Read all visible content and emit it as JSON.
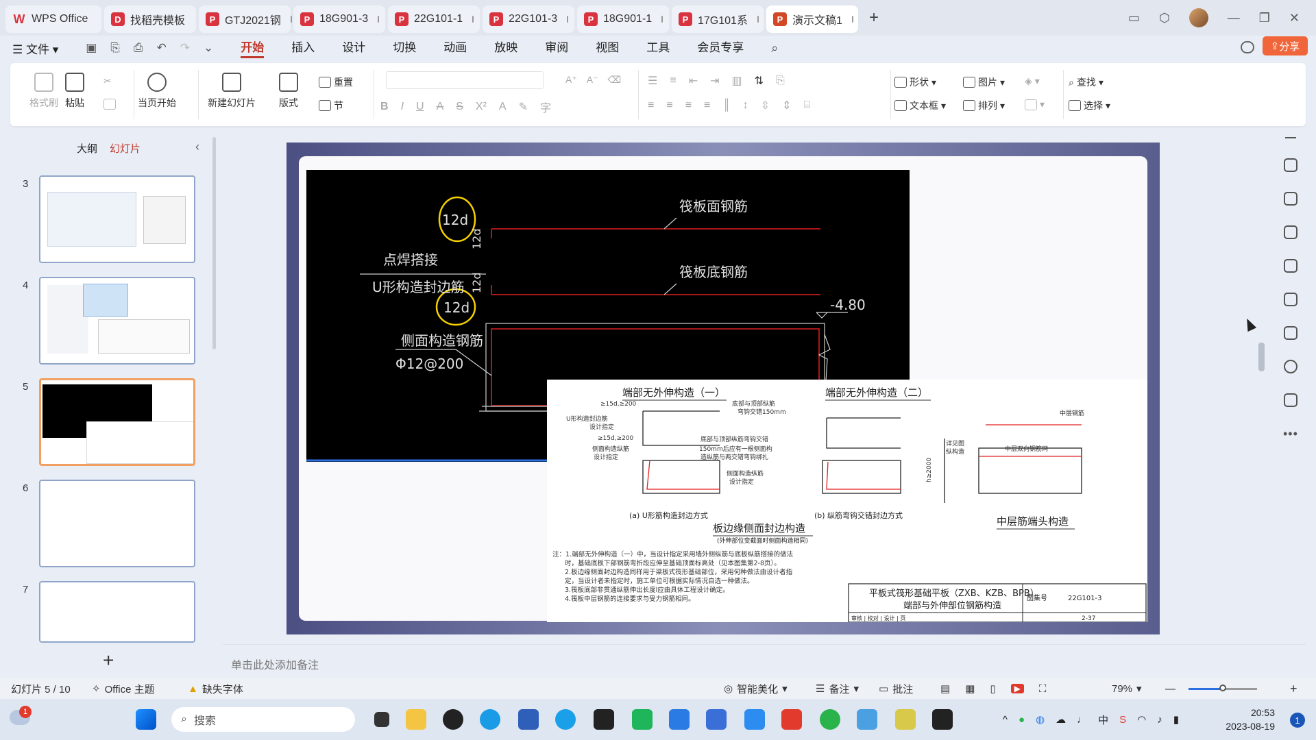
{
  "tabs": [
    {
      "label": "WPS Office",
      "icon": "W",
      "kind": "home"
    },
    {
      "label": "找稻壳模板",
      "icon": "D",
      "kind": "template"
    },
    {
      "label": "GTJ2021钢",
      "icon": "P",
      "kind": "pdf"
    },
    {
      "label": "18G901-3",
      "icon": "P",
      "kind": "pdf"
    },
    {
      "label": "22G101-1",
      "icon": "P",
      "kind": "pdf"
    },
    {
      "label": "22G101-3",
      "icon": "P",
      "kind": "pdf"
    },
    {
      "label": "18G901-1",
      "icon": "P",
      "kind": "pdf"
    },
    {
      "label": "17G101系",
      "icon": "P",
      "kind": "pdf"
    },
    {
      "label": "演示文稿1",
      "icon": "P",
      "kind": "ppt",
      "active": true
    }
  ],
  "menu": {
    "file": "文件",
    "items": [
      "开始",
      "插入",
      "设计",
      "切换",
      "动画",
      "放映",
      "审阅",
      "视图",
      "工具",
      "会员专享"
    ],
    "active": "开始",
    "share": "分享"
  },
  "ribbon": {
    "format_painter": "格式刷",
    "paste": "粘贴",
    "from_current": "当页开始",
    "new_slide": "新建幻灯片",
    "layout": "版式",
    "reset": "重置",
    "section": "节",
    "shape": "形状",
    "picture": "图片",
    "find": "查找",
    "textbox": "文本框",
    "arrange": "排列",
    "select": "选择"
  },
  "left_panel": {
    "tab_outline": "大纲",
    "tab_slides": "幻灯片",
    "slides": [
      {
        "number": "3"
      },
      {
        "number": "4"
      },
      {
        "number": "5",
        "selected": true
      },
      {
        "number": "6"
      },
      {
        "number": "7"
      }
    ]
  },
  "cad": {
    "labels": [
      "12d",
      "12d",
      "12d",
      "12d",
      "点焊搭接",
      "U形构造封边筋",
      "侧面构造钢筋",
      "Φ12@200",
      "筏板面钢筋",
      "筏板底钢筋",
      "-4.80"
    ]
  },
  "paper": {
    "title1": "端部无外伸构造（一）",
    "title2": "端部无外伸构造（二）",
    "sub_a": "(a) U形筋构造封边方式",
    "sub_b": "(b) 纵筋弯钩交错封边方式",
    "caption_main": "板边缘侧面封边构造",
    "caption_note": "(外伸部位变截面时侧面构造相同)",
    "caption_mid": "中层筋端头构造",
    "small_labels": [
      "≥15d,≥200",
      "U形构造封边筋",
      "设计指定",
      "≥15d,≥200",
      "侧面构造纵筋",
      "设计指定",
      "底部与顶部纵筋",
      "弯钩交错150mm",
      "底部与顶部纵筋弯钩交错",
      "150mm后应有一根侧面构",
      "造纵筋与两交错弯钩绑扎",
      "侧面构造纵筋",
      "设计指定",
      "中层钢筋",
      "详见图",
      "纵构造",
      "中层双向钢筋网",
      "h≥2000"
    ],
    "notes": [
      "注：1.端部无外伸构造（一）中，当设计指定采用墙外侧纵筋与底板纵筋搭接的做法",
      "时，基础底板下部钢筋弯折段应伸至基础顶面标高处（见本图集第2-8页）。",
      "2.板边缘侧面封边构造同样用于梁板式筏形基础部位，采用何种做法由设计者指",
      "定，当设计者未指定时，施工单位可根据实际情况自选一种做法。",
      "3.筏板底部非贯通纵筋伸出长度l应由具体工程设计确定。",
      "4.筏板中层钢筋的连接要求与受力钢筋相同。"
    ],
    "titleblock_line1": "平板式筏形基础平板（ZXB、KZB、BPB）",
    "titleblock_line2": "端部与外伸部位钢筋构造",
    "atlas_label": "图集号",
    "atlas_no": "22G101-3",
    "review_row": "审核 | 校对 | 设计 | 页",
    "page_no": "2-37"
  },
  "notes_placeholder": "单击此处添加备注",
  "status": {
    "slide_info": "幻灯片 5 / 10",
    "theme": "Office 主题",
    "missing_font": "缺失字体",
    "beautify": "智能美化",
    "notes": "备注",
    "comment": "批注",
    "zoom": "79%",
    "zoom_fraction": 0.5
  },
  "taskbar": {
    "search_placeholder": "搜索",
    "time": "20:53",
    "date": "2023-08-19",
    "weather_badge": "1",
    "notification_count": "1",
    "ime": "中"
  },
  "colors": {
    "accent": "#c0392b",
    "share": "#f0663a",
    "cad_red": "#e02020",
    "cad_yellow": "#f5d000",
    "stage": "#5a5e8e"
  }
}
